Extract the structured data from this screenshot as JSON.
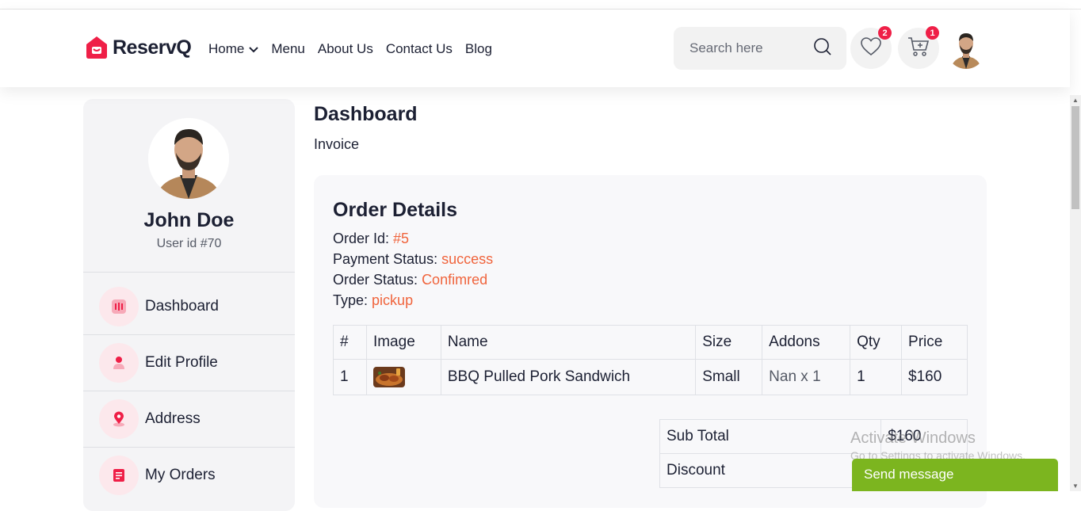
{
  "brand": {
    "name": "ReservQ",
    "accent": "#ef1f47",
    "highlight": "#f0643c"
  },
  "nav": [
    {
      "label": "Home",
      "has_dropdown": true
    },
    {
      "label": "Menu"
    },
    {
      "label": "About Us"
    },
    {
      "label": "Contact Us"
    },
    {
      "label": "Blog"
    }
  ],
  "search": {
    "placeholder": "Search here",
    "icon": "search-icon"
  },
  "header_icons": {
    "wishlist": {
      "icon": "heart-icon",
      "count": "2"
    },
    "cart": {
      "icon": "cart-icon",
      "count": "1"
    }
  },
  "sidebar": {
    "name": "John Doe",
    "user_id": "User id #70",
    "items": [
      {
        "label": "Dashboard",
        "icon": "dashboard-icon"
      },
      {
        "label": "Edit Profile",
        "icon": "user-icon"
      },
      {
        "label": "Address",
        "icon": "location-pin-icon"
      },
      {
        "label": "My Orders",
        "icon": "receipt-icon"
      }
    ]
  },
  "main": {
    "title": "Dashboard",
    "breadcrumb": "Invoice",
    "order": {
      "heading": "Order Details",
      "order_id_label": "Order Id:",
      "order_id": "#5",
      "payment_label": "Payment Status:",
      "payment_status": "success",
      "status_label": "Order Status:",
      "order_status": "Confimred",
      "type_label": "Type:",
      "type": "pickup"
    },
    "table": {
      "headers": [
        "#",
        "Image",
        "Name",
        "Size",
        "Addons",
        "Qty",
        "Price"
      ],
      "rows": [
        {
          "num": "1",
          "name": "BBQ Pulled Pork Sandwich",
          "size": "Small",
          "addons": "Nan x 1",
          "qty": "1",
          "price": "$160"
        }
      ]
    },
    "totals": [
      {
        "label": "Sub Total",
        "value": "$160"
      },
      {
        "label": "Discount",
        "value": ""
      }
    ]
  },
  "overlay": {
    "watermark_title": "Activate Windows",
    "watermark_sub": "Go to Settings to activate Windows.",
    "send_message": "Send message"
  }
}
